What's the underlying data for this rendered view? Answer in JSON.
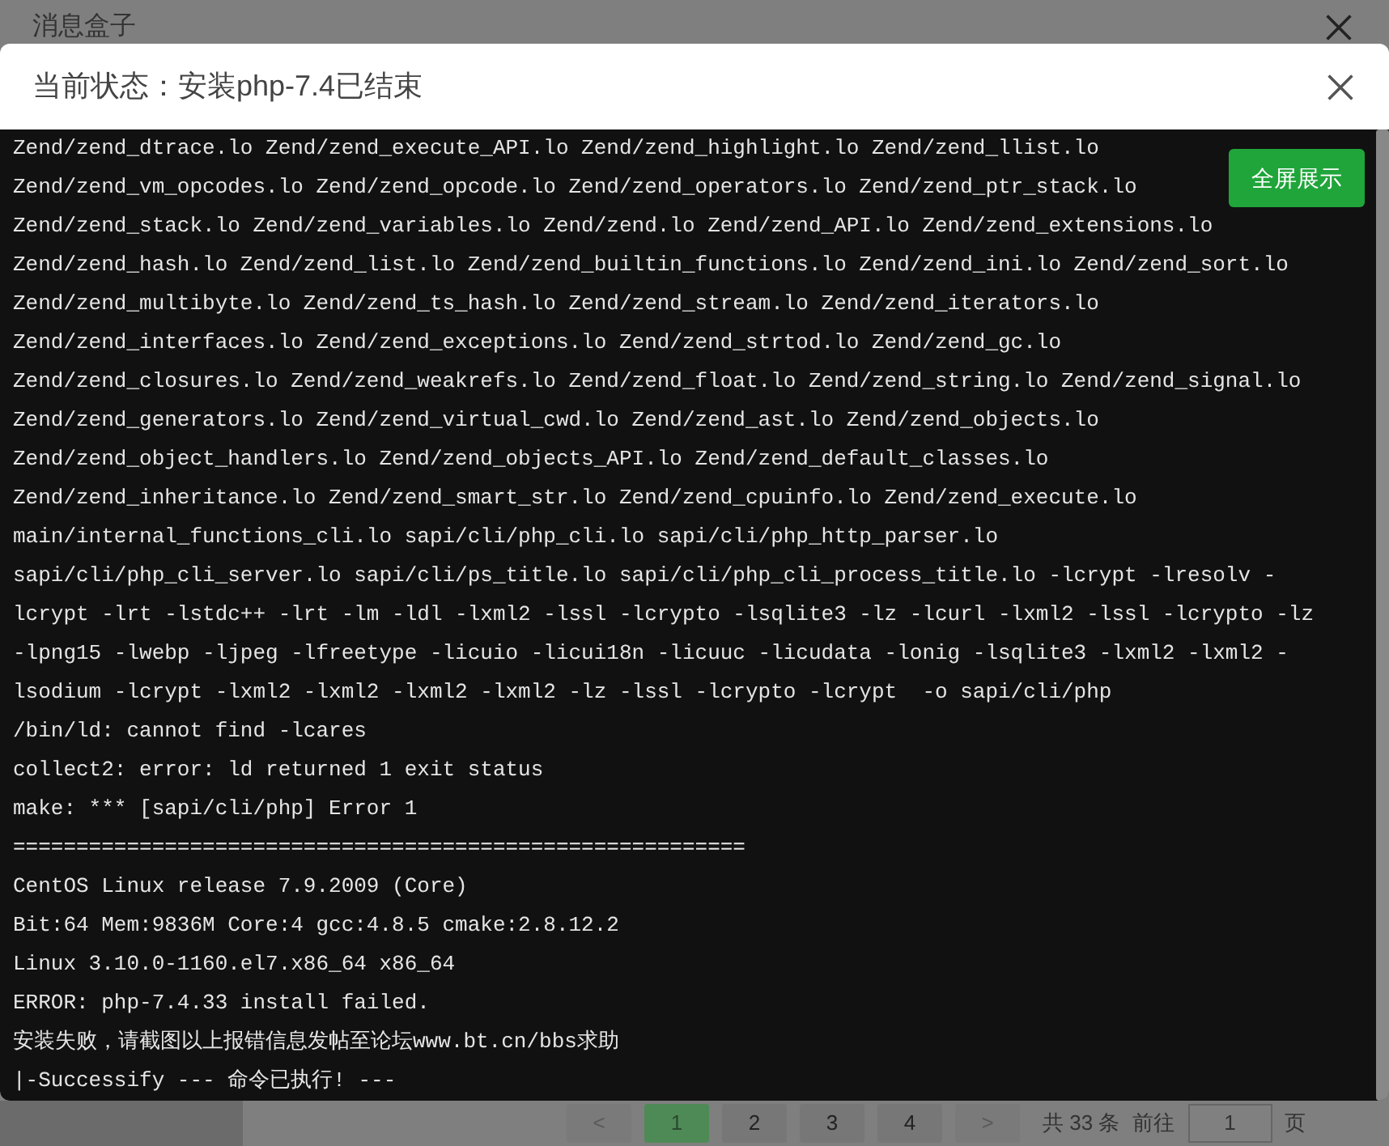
{
  "background_dialog": {
    "title": "消息盒子"
  },
  "pagination": {
    "prev": "<",
    "pages": [
      {
        "label": "1",
        "selected": true
      },
      {
        "label": "2",
        "selected": false
      },
      {
        "label": "3",
        "selected": false
      },
      {
        "label": "4",
        "selected": false
      }
    ],
    "next": ">",
    "total": "共 33 条",
    "goto": "前往",
    "page_input": "1",
    "page_suffix": "页"
  },
  "modal": {
    "title": "当前状态：安装php-7.4已结束",
    "fullscreen_button": "全屏展示",
    "log_lines": [
      "Zend/zend_dtrace.lo Zend/zend_execute_API.lo Zend/zend_highlight.lo Zend/zend_llist.lo",
      "Zend/zend_vm_opcodes.lo Zend/zend_opcode.lo Zend/zend_operators.lo Zend/zend_ptr_stack.lo",
      "Zend/zend_stack.lo Zend/zend_variables.lo Zend/zend.lo Zend/zend_API.lo Zend/zend_extensions.lo",
      "Zend/zend_hash.lo Zend/zend_list.lo Zend/zend_builtin_functions.lo Zend/zend_ini.lo Zend/zend_sort.lo",
      "Zend/zend_multibyte.lo Zend/zend_ts_hash.lo Zend/zend_stream.lo Zend/zend_iterators.lo",
      "Zend/zend_interfaces.lo Zend/zend_exceptions.lo Zend/zend_strtod.lo Zend/zend_gc.lo",
      "Zend/zend_closures.lo Zend/zend_weakrefs.lo Zend/zend_float.lo Zend/zend_string.lo Zend/zend_signal.lo",
      "Zend/zend_generators.lo Zend/zend_virtual_cwd.lo Zend/zend_ast.lo Zend/zend_objects.lo",
      "Zend/zend_object_handlers.lo Zend/zend_objects_API.lo Zend/zend_default_classes.lo",
      "Zend/zend_inheritance.lo Zend/zend_smart_str.lo Zend/zend_cpuinfo.lo Zend/zend_execute.lo",
      "main/internal_functions_cli.lo sapi/cli/php_cli.lo sapi/cli/php_http_parser.lo",
      "sapi/cli/php_cli_server.lo sapi/cli/ps_title.lo sapi/cli/php_cli_process_title.lo -lcrypt -lresolv -",
      "lcrypt -lrt -lstdc++ -lrt -lm -ldl -lxml2 -lssl -lcrypto -lsqlite3 -lz -lcurl -lxml2 -lssl -lcrypto -lz",
      "-lpng15 -lwebp -ljpeg -lfreetype -licuio -licui18n -licuuc -licudata -lonig -lsqlite3 -lxml2 -lxml2 -",
      "lsodium -lcrypt -lxml2 -lxml2 -lxml2 -lxml2 -lz -lssl -lcrypto -lcrypt  -o sapi/cli/php",
      "/bin/ld: cannot find -lcares",
      "collect2: error: ld returned 1 exit status",
      "make: *** [sapi/cli/php] Error 1",
      "==========================================================",
      "CentOS Linux release 7.9.2009 (Core)",
      "Bit:64 Mem:9836M Core:4 gcc:4.8.5 cmake:2.8.12.2",
      "Linux 3.10.0-1160.el7.x86_64 x86_64",
      "ERROR: php-7.4.33 install failed.",
      "安装失败，请截图以上报错信息发帖至论坛www.bt.cn/bbs求助",
      "|-Successify --- 命令已执行! ---"
    ]
  }
}
